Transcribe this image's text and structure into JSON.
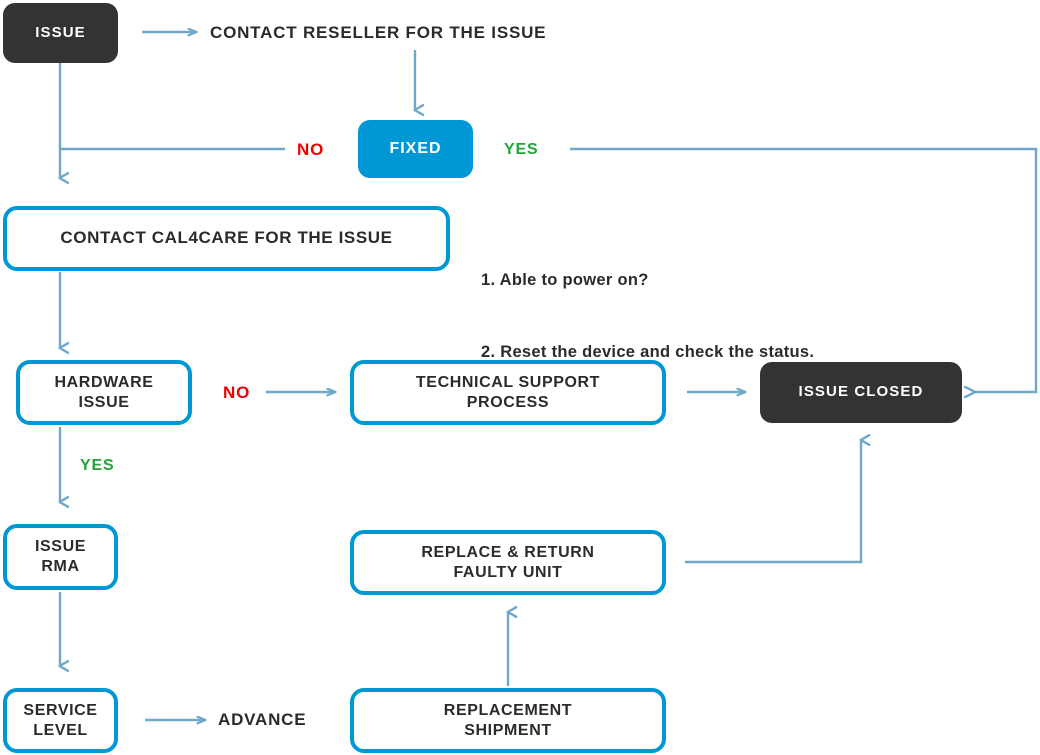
{
  "diagram": {
    "title": "RMA / Support Issue Escalation Flowchart",
    "colors": {
      "accent_blue": "#0098d4",
      "connector_blue": "#6fa8c8",
      "dark_box": "#333333",
      "yes_green": "#24a33c",
      "no_red": "#ee0000",
      "text_dark": "#2b2b2b"
    },
    "nodes": [
      {
        "id": "issue",
        "label": "ISSUE",
        "style": "dark"
      },
      {
        "id": "fixed",
        "label": "FIXED",
        "style": "filled-blue"
      },
      {
        "id": "contact_cal4care",
        "label": "CONTACT CAL4CARE FOR THE ISSUE",
        "style": "outlined"
      },
      {
        "id": "hardware_issue",
        "label": "HARDWARE\nISSUE",
        "line1": "HARDWARE",
        "line2": "ISSUE",
        "style": "outlined"
      },
      {
        "id": "technical_support",
        "label": "TECHNICAL SUPPORT\nPROCESS",
        "line1": "TECHNICAL SUPPORT",
        "line2": "PROCESS",
        "style": "outlined"
      },
      {
        "id": "issue_closed",
        "label": "ISSUE CLOSED",
        "style": "dark"
      },
      {
        "id": "issue_rma",
        "label": "ISSUE\nRMA",
        "line1": "ISSUE",
        "line2": "RMA",
        "style": "outlined"
      },
      {
        "id": "replace_return",
        "label": "REPLACE & RETURN\nFAULTY UNIT",
        "line1": "REPLACE & RETURN",
        "line2": "FAULTY UNIT",
        "style": "outlined"
      },
      {
        "id": "service_level",
        "label": "SERVICE\nLEVEL",
        "line1": "SERVICE",
        "line2": "LEVEL",
        "style": "outlined"
      },
      {
        "id": "replacement_shipment",
        "label": "REPLACEMENT\nSHIPMENT",
        "line1": "REPLACEMENT",
        "line2": "SHIPMENT",
        "style": "outlined"
      }
    ],
    "labels": {
      "contact_reseller": "CONTACT RESELLER FOR THE ISSUE",
      "no_fixed": "NO",
      "yes_fixed": "YES",
      "no_hardware": "NO",
      "yes_hardware": "YES",
      "advance": "ADVANCE"
    },
    "notes": {
      "line1": "1. Able to power on?",
      "line2": "2. Reset the device and check the status."
    }
  }
}
